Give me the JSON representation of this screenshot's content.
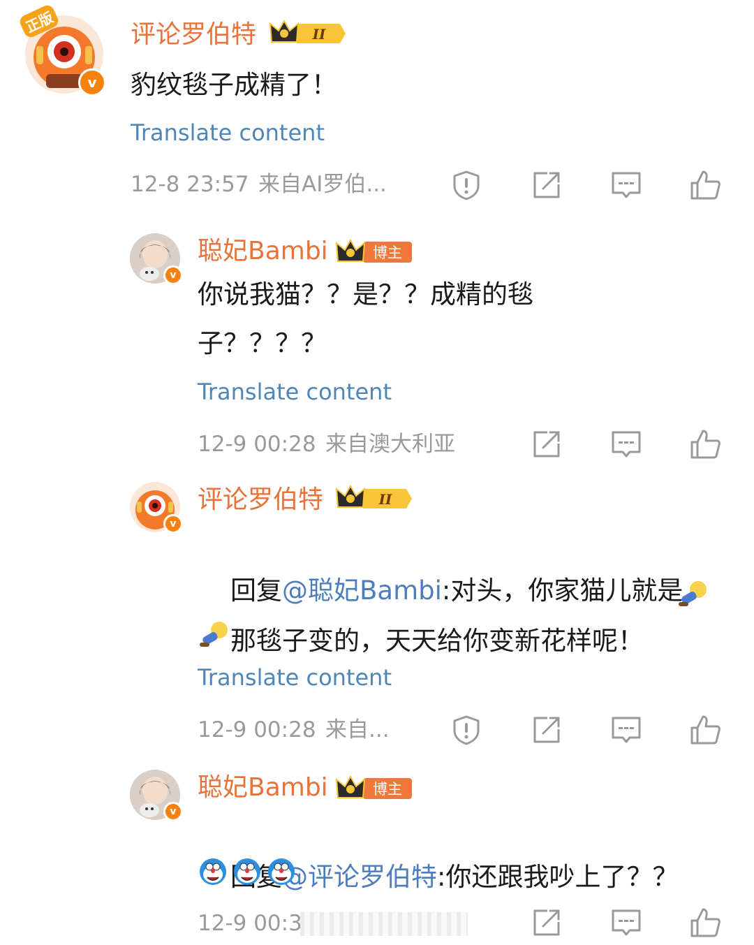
{
  "comments": [
    {
      "username": "评论罗伯特",
      "badge_level": "II",
      "avatar_tag": "正版",
      "text": "豹纹毯子成精了！",
      "translate": "Translate content",
      "time": "12-8 23:57",
      "source": "来自AI罗伯...",
      "has_report": true
    },
    {
      "username": "聪妃Bambi",
      "badge_label": "博主",
      "text_line1": "你说我猫？？是？？成精的毯",
      "text_line2": "子？？？？",
      "translate": "Translate content",
      "time": "12-9 00:28",
      "source": "来自澳大利亚",
      "has_report": false
    },
    {
      "username": "评论罗伯特",
      "badge_level": "II",
      "reply_prefix": "回复",
      "mention": "@聪妃Bambi",
      "text_line1": ":对头，你家猫儿就是",
      "text_line2": "那毯子变的，天天给你变新花样呢！",
      "translate": "Translate content",
      "time": "12-9 00:28",
      "source": "来自...",
      "has_report": true
    },
    {
      "username": "聪妃Bambi",
      "badge_label": "博主",
      "reply_prefix": "回复",
      "mention": "@评论罗伯特",
      "text_line1": ":你还跟我吵上了？？",
      "time": "12-9 00:3",
      "has_report": false
    }
  ],
  "icons": {
    "report": "shield-exclamation-icon",
    "share": "share-arrow-icon",
    "reply": "comment-bubble-icon",
    "like": "thumbs-up-icon"
  },
  "colors": {
    "username": "#e8733a",
    "link": "#4f86b7",
    "meta": "#9a9a9a",
    "badge_orange": "#f5820d"
  }
}
